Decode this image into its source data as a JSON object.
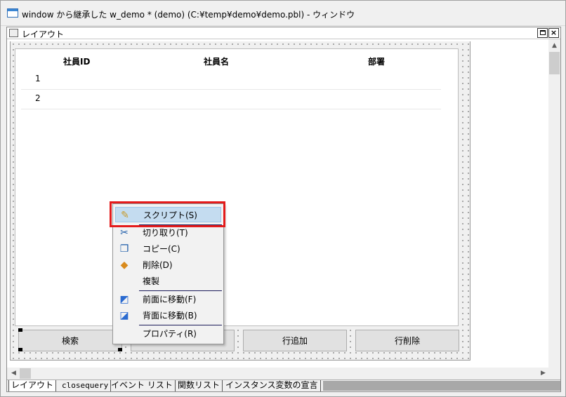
{
  "window": {
    "title": "window から継承した w_demo * (demo) (C:¥temp¥demo¥demo.pbl) - ウィンドウ"
  },
  "painter": {
    "title": "レイアウト",
    "restore_label": "",
    "close_label": "×"
  },
  "datawindow": {
    "columns": [
      "社員ID",
      "社員名",
      "部署"
    ],
    "rows": [
      "1",
      "2"
    ]
  },
  "buttons": {
    "search": "検索",
    "add_row": "行追加",
    "delete_row": "行削除"
  },
  "context_menu": {
    "items": [
      {
        "label": "スクリプト(S)",
        "icon": "script-icon"
      },
      {
        "label": "切り取り(T)",
        "icon": "cut-icon"
      },
      {
        "label": "コピー(C)",
        "icon": "copy-icon"
      },
      {
        "label": "削除(D)",
        "icon": "delete-icon"
      },
      {
        "label": "複製",
        "icon": ""
      },
      {
        "label": "前面に移動(F)",
        "icon": "bring-to-front-icon"
      },
      {
        "label": "背面に移動(B)",
        "icon": "send-to-back-icon"
      },
      {
        "label": "プロパティ(R)",
        "icon": ""
      }
    ]
  },
  "tabs": [
    "レイアウト",
    "closequery",
    "イベント リスト",
    "関数リスト",
    "インスタンス変数の宣言"
  ],
  "colors": {
    "highlight": "#c4dcf0",
    "annotation": "#e41b1b"
  }
}
